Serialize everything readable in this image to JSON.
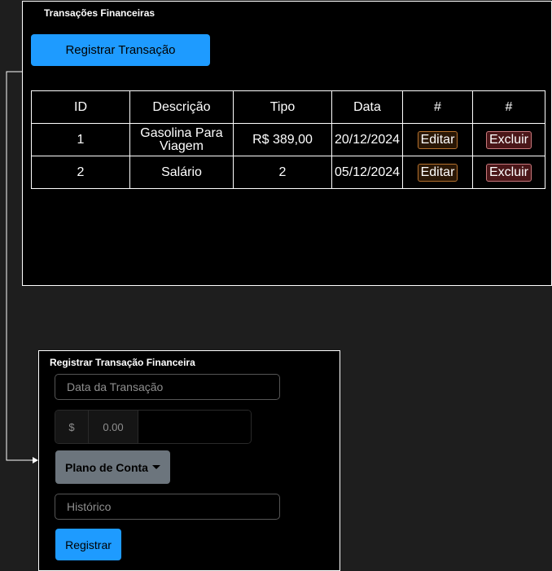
{
  "transactions_panel": {
    "title": "Transações Financeiras",
    "register_button": "Registrar Transação",
    "columns": [
      "ID",
      "Descrição",
      "Tipo",
      "Data",
      "#",
      "#"
    ],
    "rows": [
      {
        "id": "1",
        "description": "Gasolina Para Viagem",
        "type": "R$ 389,00",
        "date": "20/12/2024",
        "edit": "Editar",
        "delete": "Excluir"
      },
      {
        "id": "2",
        "description": "Salário",
        "type": "2",
        "date": "05/12/2024",
        "edit": "Editar",
        "delete": "Excluir"
      }
    ]
  },
  "form_panel": {
    "title": "Registrar Transação Financeira",
    "date_placeholder": "Data da Transação",
    "currency_symbol": "$",
    "amount_placeholder": "0.00",
    "account_dropdown": "Plano de Conta",
    "history_placeholder": "Histórico",
    "submit_button": "Registrar"
  },
  "colors": {
    "primary": "#1e9bff",
    "secondary": "#6c757d",
    "edit_border": "#b5712e",
    "delete_border": "#c9787c"
  }
}
